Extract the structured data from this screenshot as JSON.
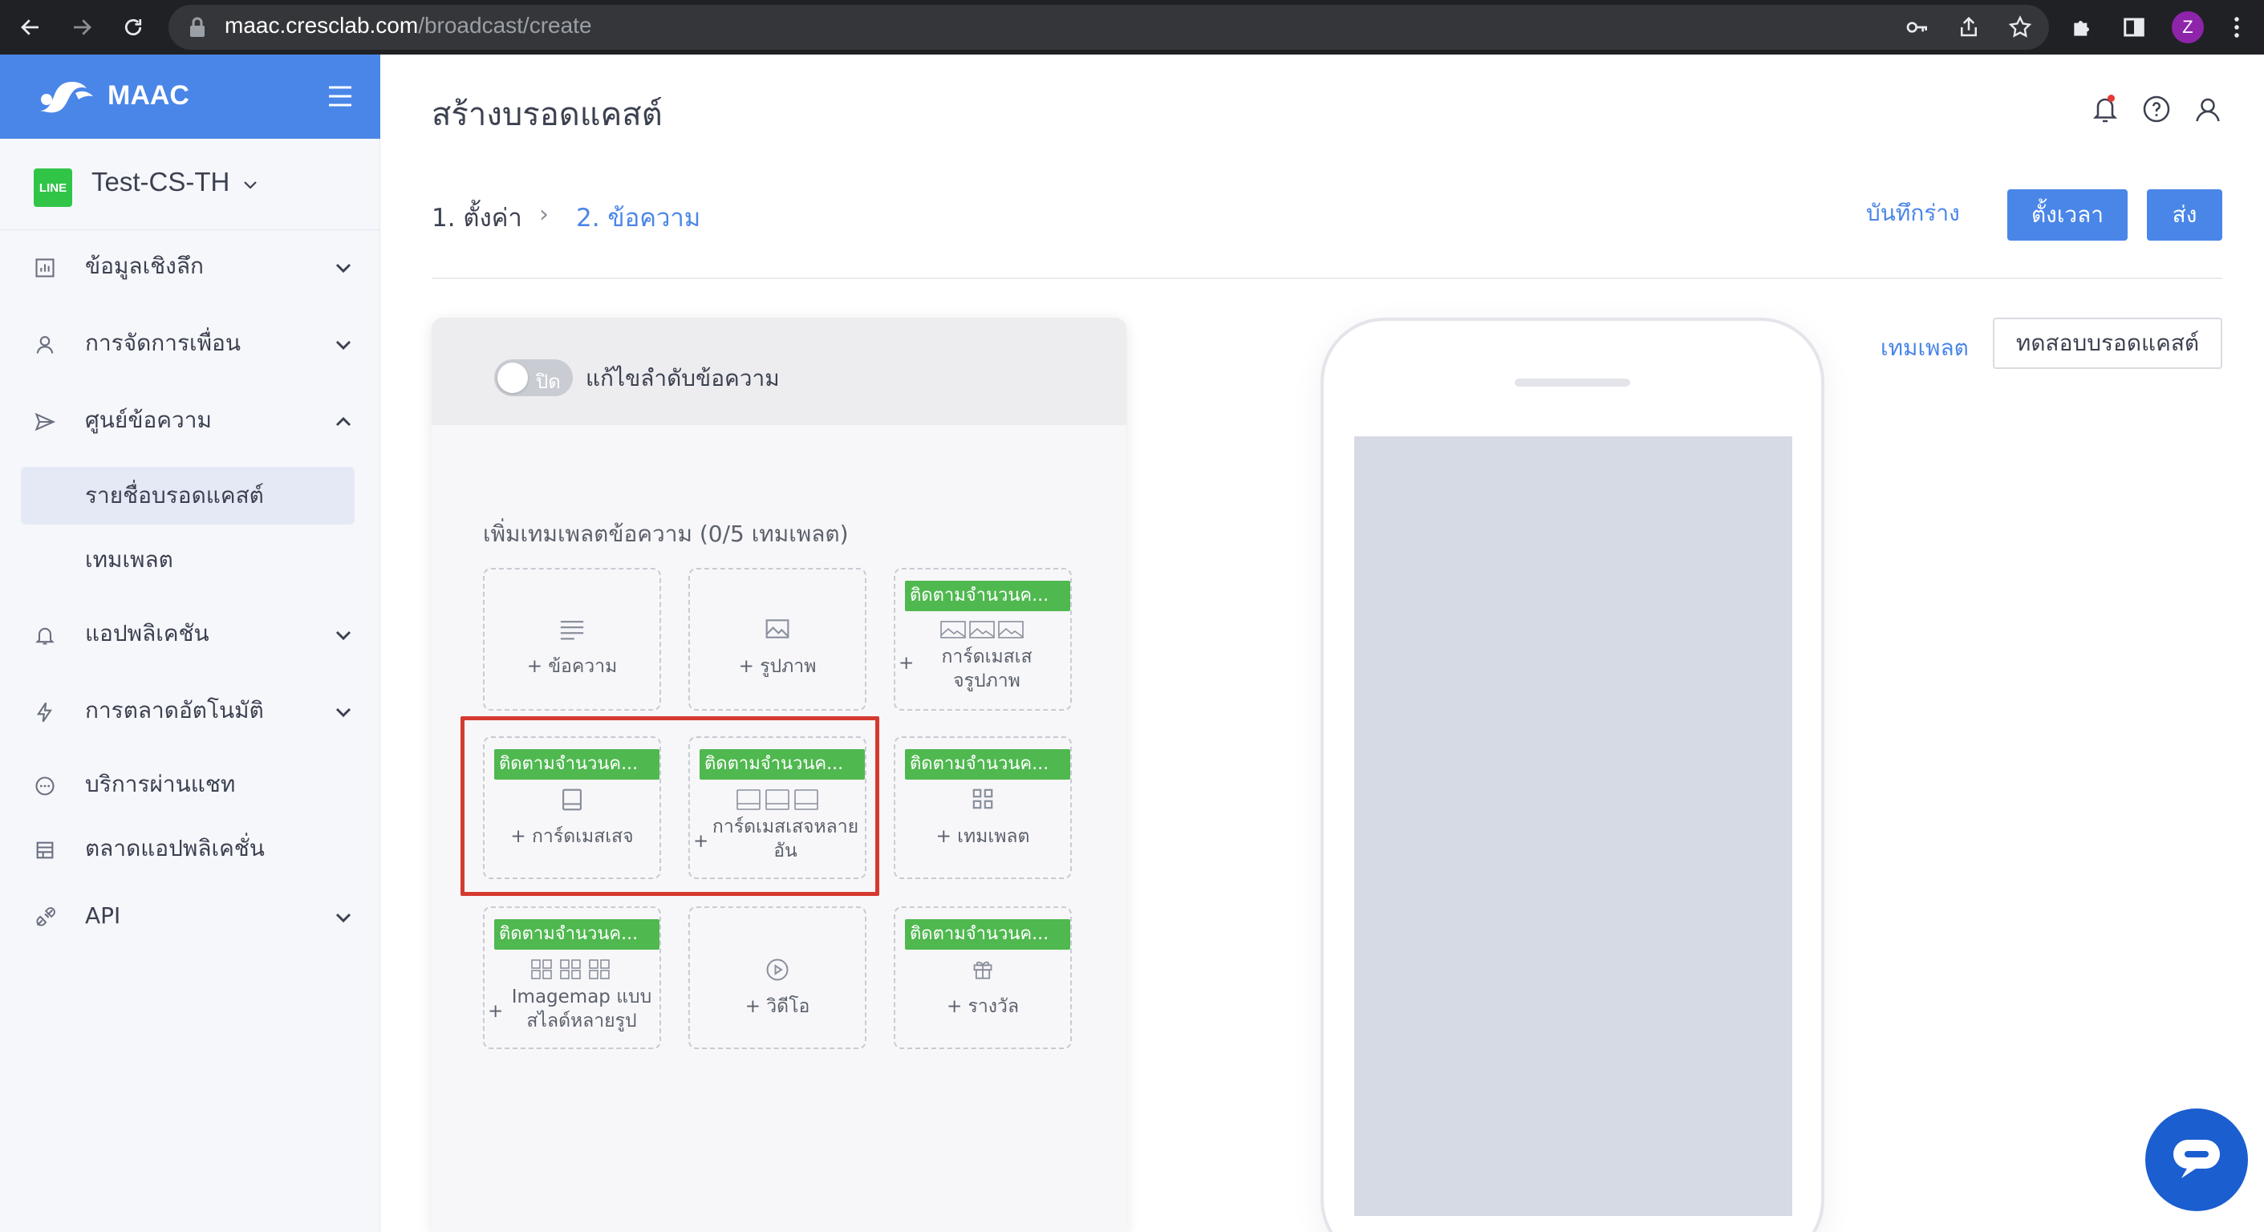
{
  "browser": {
    "url_host": "maac.cresclab.com",
    "url_path": "/broadcast/create",
    "profile_initial": "Z"
  },
  "sidebar": {
    "brand": "MAAC",
    "line_badge": "LINE",
    "account_name": "Test-CS-TH",
    "items": [
      {
        "label": "ข้อมูลเชิงลึก",
        "icon": "chart-icon",
        "expandable": true
      },
      {
        "label": "การจัดการเพื่อน",
        "icon": "user-icon",
        "expandable": true
      },
      {
        "label": "ศูนย์ข้อความ",
        "icon": "send-icon",
        "expandable": true,
        "expanded": true
      },
      {
        "label": "แอปพลิเคชัน",
        "icon": "bell-icon",
        "expandable": true
      },
      {
        "label": "การตลาดอัตโนมัติ",
        "icon": "bolt-icon",
        "expandable": true
      },
      {
        "label": "บริการผ่านแชท",
        "icon": "chat-bubble-icon",
        "expandable": false
      },
      {
        "label": "ตลาดแอปพลิเคชั่น",
        "icon": "store-icon",
        "expandable": false
      },
      {
        "label": "API",
        "icon": "api-icon",
        "expandable": true
      }
    ],
    "subitems": [
      {
        "label": "รายชื่อบรอดแคสต์",
        "active": true
      },
      {
        "label": "เทมเพลต",
        "active": false
      }
    ]
  },
  "header": {
    "title": "สร้างบรอดแคสต์",
    "step1": "1. ตั้งค่า",
    "step_separator": "›",
    "step2": "2. ข้อความ",
    "save_draft": "บันทึกร่าง",
    "schedule": "ตั้งเวลา",
    "send": "ส่ง"
  },
  "editor": {
    "toggle_state": "ปิด",
    "toggle_label": "แก้ไขลำดับข้อความ",
    "heading": "เพิ่มเทมเพลตข้อความ (0/5 เทมเพลต)",
    "cards": [
      {
        "badge": "",
        "label": "+ ข้อความ",
        "icon": "text-lines-icon"
      },
      {
        "badge": "",
        "label": "+ รูปภาพ",
        "icon": "image-icon"
      },
      {
        "badge": "ติดตามจำนวนค...",
        "label": "การ์ดเมสเสจรูปภาพ",
        "icon": "image-carousel-icon"
      },
      {
        "badge": "ติดตามจำนวนค...",
        "label": "+ การ์ดเมสเสจ",
        "icon": "card-icon"
      },
      {
        "badge": "ติดตามจำนวนค...",
        "label": "การ์ดเมสเสจหลายอัน",
        "icon": "card-carousel-icon"
      },
      {
        "badge": "ติดตามจำนวนค...",
        "label": "+ เทมเพลต",
        "icon": "grid-icon"
      },
      {
        "badge": "ติดตามจำนวนค...",
        "label": "Imagemap แบบสไลด์หลายรูป",
        "icon": "imagemap-carousel-icon"
      },
      {
        "badge": "",
        "label": "+ วิดีโอ",
        "icon": "play-icon"
      },
      {
        "badge": "ติดตามจำนวนค...",
        "label": "+ รางวัล",
        "icon": "gift-icon"
      }
    ]
  },
  "preview": {
    "templates_link": "เทมเพลต",
    "test_button": "ทดสอบบรอดแคสต์"
  },
  "colors": {
    "primary": "#4a86e8",
    "badge_green": "#4fb84f",
    "highlight_red": "#d43a2f",
    "chat_fab": "#1b5ecf"
  }
}
